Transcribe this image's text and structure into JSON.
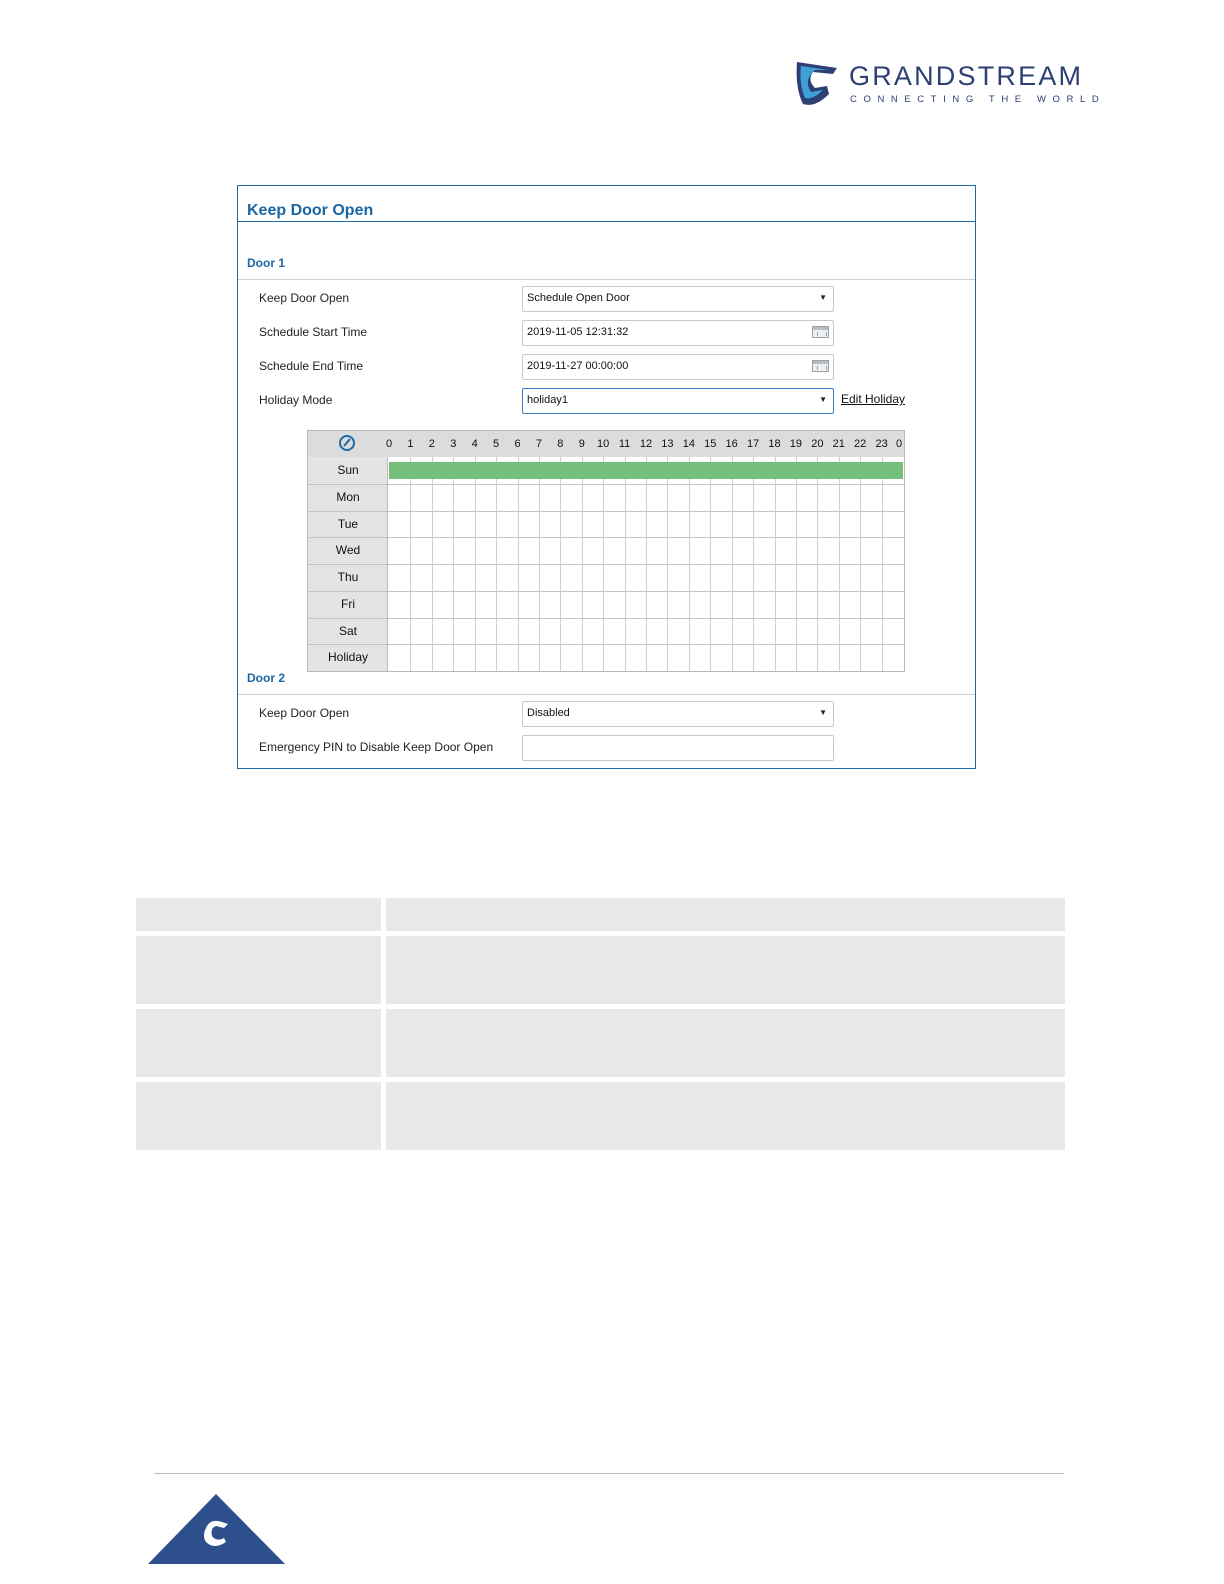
{
  "logo": {
    "wordmark": "GRANDSTREAM",
    "tagline": "CONNECTING THE WORLD",
    "color": "#2d3f73"
  },
  "panel": {
    "title": "Keep Door Open",
    "accent_color": "#1a66a3",
    "door1": {
      "section_title": "Door 1",
      "keep_door_open": {
        "label": "Keep Door Open",
        "value": "Schedule Open Door"
      },
      "schedule_start": {
        "label": "Schedule Start Time",
        "value": "2019-11-05 12:31:32"
      },
      "schedule_end": {
        "label": "Schedule End Time",
        "value": "2019-11-27 00:00:00"
      },
      "holiday_mode": {
        "label": "Holiday Mode",
        "value": "holiday1",
        "edit_link": "Edit Holiday"
      }
    },
    "schedule": {
      "hours": [
        "0",
        "1",
        "2",
        "3",
        "4",
        "5",
        "6",
        "7",
        "8",
        "9",
        "10",
        "11",
        "12",
        "13",
        "14",
        "15",
        "16",
        "17",
        "18",
        "19",
        "20",
        "21",
        "22",
        "23",
        "0"
      ],
      "days": [
        "Sun",
        "Mon",
        "Tue",
        "Wed",
        "Thu",
        "Fri",
        "Sat",
        "Holiday"
      ],
      "active": {
        "Sun": [
          0,
          24
        ]
      },
      "active_color": "#74c07a"
    },
    "door2": {
      "section_title": "Door 2",
      "keep_door_open": {
        "label": "Keep Door Open",
        "value": "Disabled"
      },
      "emergency_pin": {
        "label": "Emergency PIN to Disable Keep Door Open",
        "value": ""
      }
    }
  }
}
